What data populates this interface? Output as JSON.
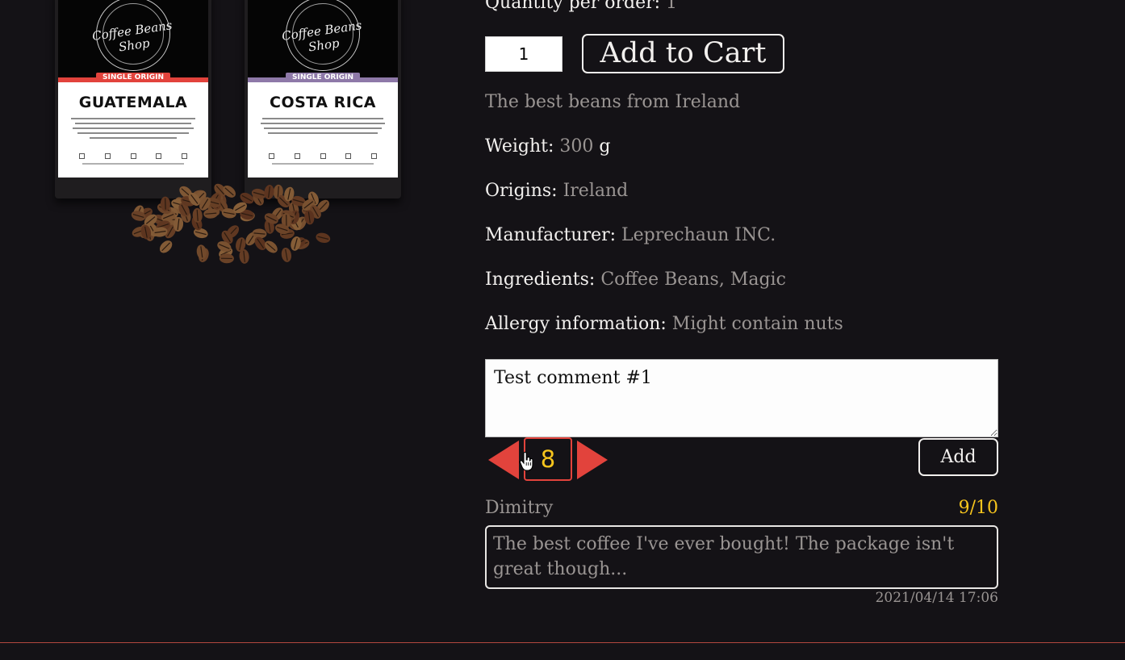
{
  "product": {
    "quantity_label": "Quantity per order:",
    "quantity_value": "1",
    "cart_quantity": "1",
    "add_to_cart_label": "Add to Cart",
    "description": "The best beans from Ireland",
    "image": {
      "bags": [
        {
          "logo": "Coffee Beans Shop",
          "badge": "SINGLE ORIGIN",
          "country": "GUATEMALA",
          "accent": "#e2433c"
        },
        {
          "logo": "Coffee Beans Shop",
          "badge": "SINGLE ORIGIN",
          "country": "COSTA RICA",
          "accent": "#8e79a8"
        }
      ]
    },
    "properties": {
      "weight": {
        "label": "Weight:",
        "value": "300",
        "unit": "g"
      },
      "origins": {
        "label": "Origins:",
        "value": "Ireland"
      },
      "manufacturer": {
        "label": "Manufacturer:",
        "value": "Leprechaun INC."
      },
      "ingredients": {
        "label": "Ingredients:",
        "value": "Coffee Beans, Magic"
      },
      "allergy": {
        "label": "Allergy information:",
        "value": "Might contain nuts"
      }
    }
  },
  "comment_form": {
    "text": "Test comment #1",
    "rating": "8",
    "add_label": "Add"
  },
  "reviews": [
    {
      "author": "Dimitry",
      "score": "9/10",
      "text": "The best coffee I've ever bought! The package isn't great though...",
      "date": "2021/04/14 17:06"
    }
  ],
  "colors": {
    "background": "#141216",
    "accent": "#e2433c",
    "rating": "#f7c51d",
    "muted_text": "#9a9593"
  }
}
